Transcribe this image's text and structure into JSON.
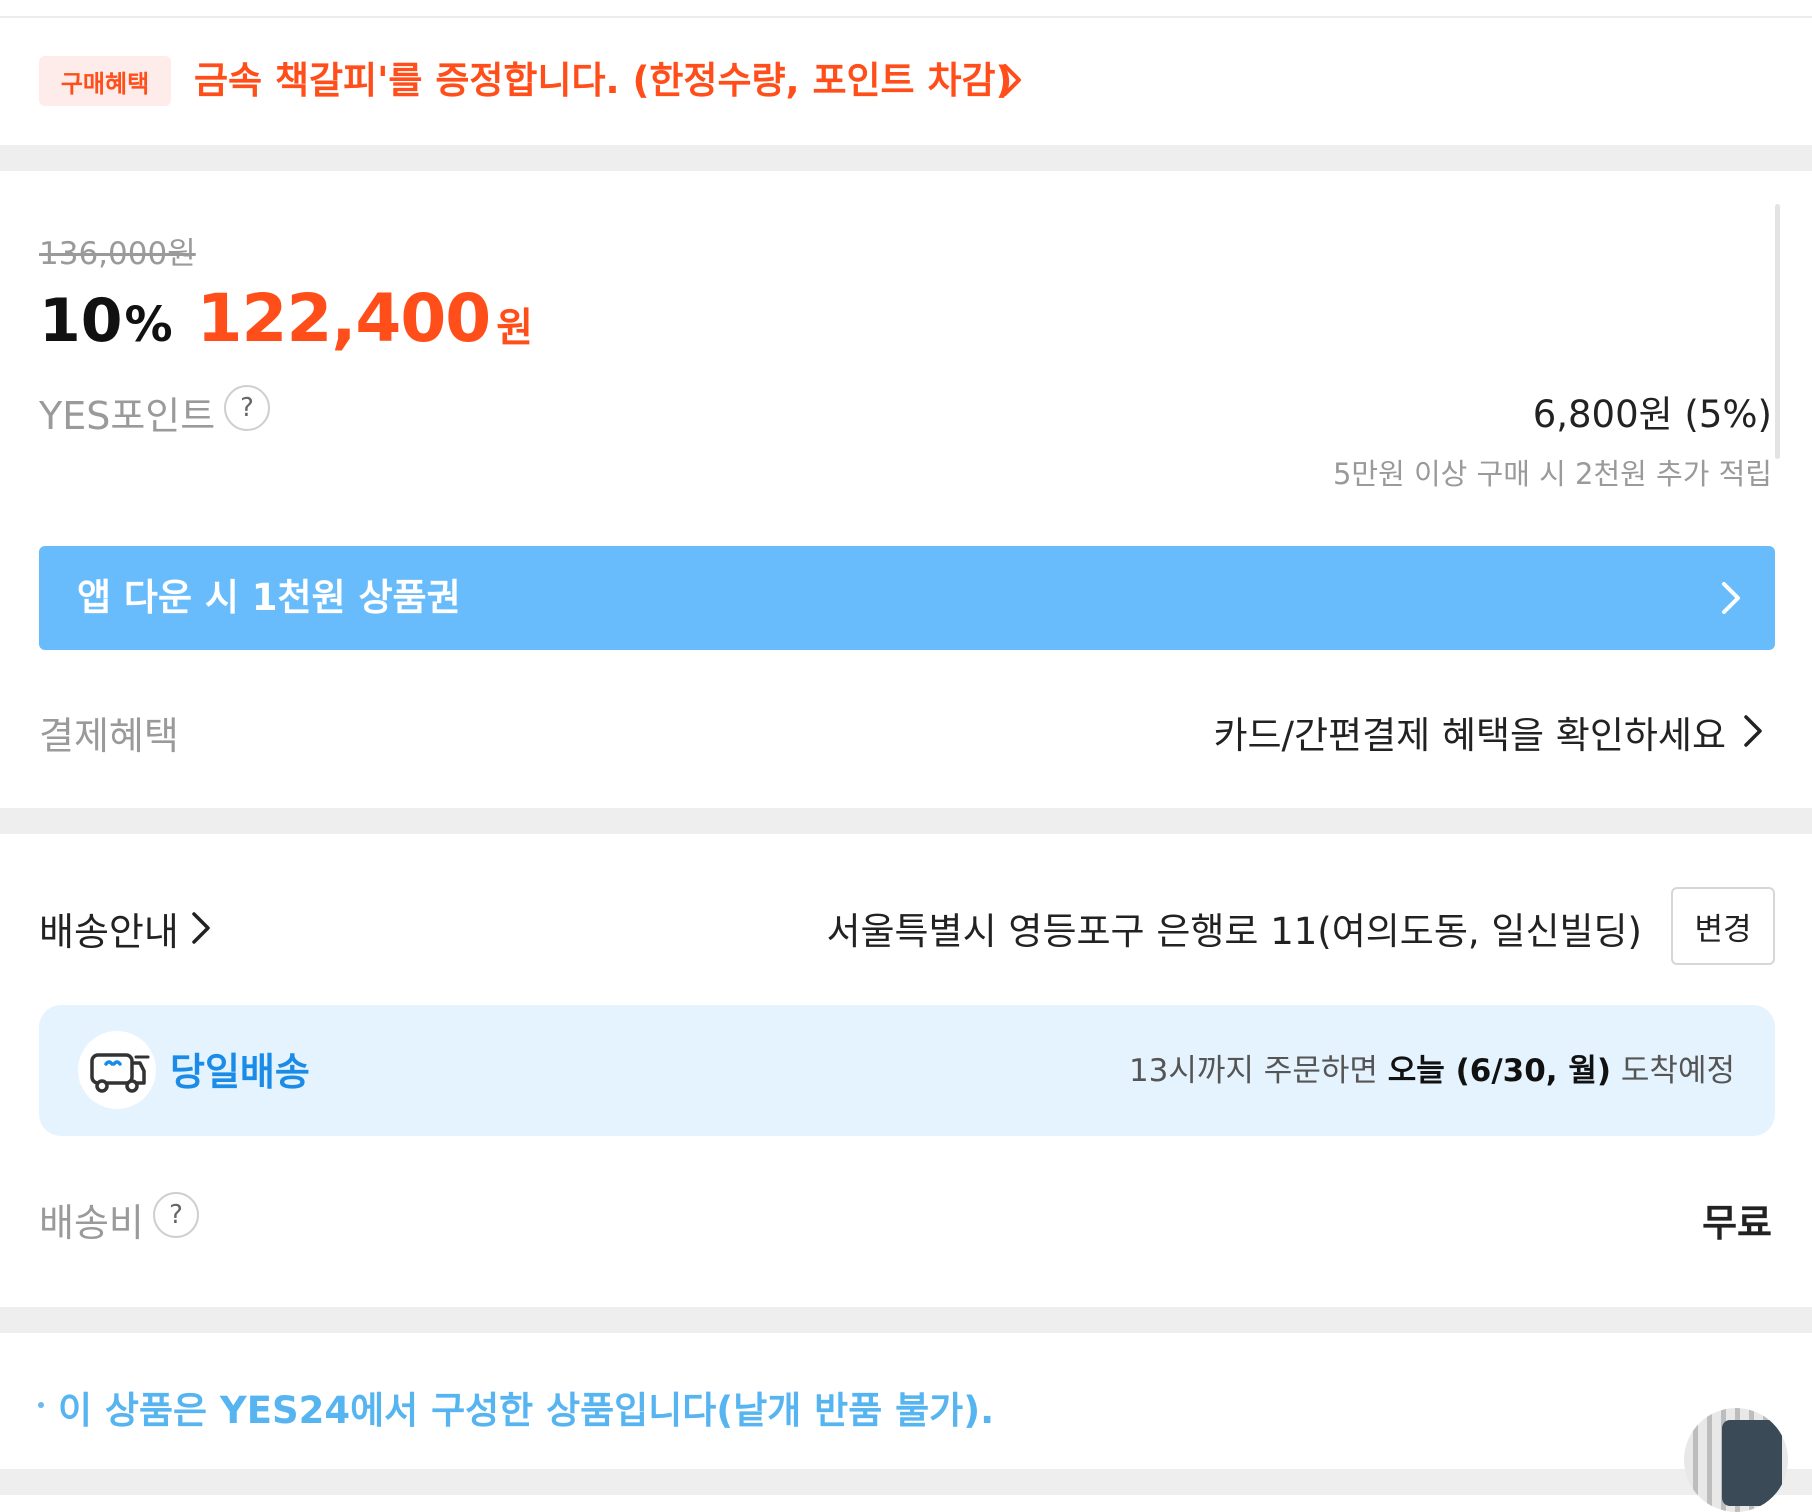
{
  "promo": {
    "badge": "구매혜택",
    "text": "금속 책갈피'를 증정합니다. (한정수량, 포인트 차감)"
  },
  "price": {
    "original": "136,000원",
    "discount_number": "10",
    "discount_unit": "%",
    "sale": "122,400",
    "currency": "원"
  },
  "points": {
    "label": "YES포인트",
    "help": "?",
    "value": "6,800원 (5%)",
    "note": "5만원 이상 구매 시 2천원 추가 적립"
  },
  "app_banner": {
    "text": "앱 다운 시 1천원 상품권"
  },
  "payment": {
    "label": "결제혜택",
    "value": "카드/간편결제 혜택을 확인하세요"
  },
  "shipping": {
    "label": "배송안내",
    "address": "서울특별시 영등포구 은행로 11(여의도동, 일신빌딩)",
    "change_label": "변경",
    "same_day": {
      "label": "당일배송",
      "prefix": "13시까지 주문하면",
      "date": "오늘 (6/30, 월)",
      "suffix": "도착예정"
    },
    "fee_label": "배송비",
    "fee_help": "?",
    "fee_value": "무료"
  },
  "notice": {
    "text": "이 상품은 YES24에서 구성한 상품입니다(낱개 반품 불가)."
  },
  "colors": {
    "accent_orange": "#ff4e1a",
    "banner_blue": "#68bcfb",
    "sameday_blue": "#1a8ce8",
    "sameday_bg": "#e5f3fe",
    "notice_blue": "#56b4f0"
  },
  "icons": [
    "chevron-right-icon",
    "help-icon",
    "truck-icon"
  ]
}
